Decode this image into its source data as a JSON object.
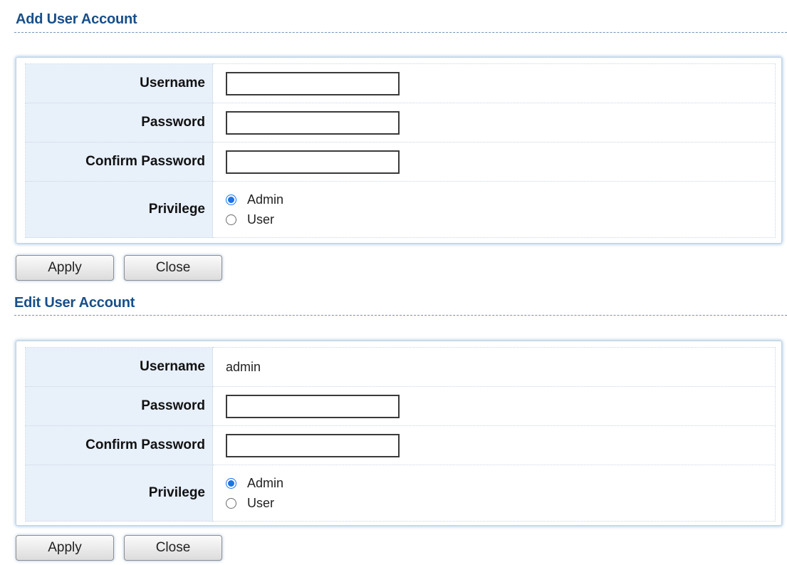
{
  "add_section": {
    "title": "Add User Account",
    "fields": {
      "username_label": "Username",
      "username_value": "",
      "password_label": "Password",
      "password_value": "",
      "confirm_label": "Confirm Password",
      "confirm_value": "",
      "privilege_label": "Privilege",
      "privilege_options": [
        "Admin",
        "User"
      ],
      "privilege_selected": "Admin"
    },
    "buttons": {
      "apply_label": "Apply",
      "close_label": "Close"
    }
  },
  "edit_section": {
    "title": "Edit User Account",
    "fields": {
      "username_label": "Username",
      "username_value": "admin",
      "password_label": "Password",
      "password_value": "",
      "confirm_label": "Confirm Password",
      "confirm_value": "",
      "privilege_label": "Privilege",
      "privilege_options": [
        "Admin",
        "User"
      ],
      "privilege_selected": "Admin"
    },
    "buttons": {
      "apply_label": "Apply",
      "close_label": "Close"
    }
  },
  "colors": {
    "title_blue": "#174f8a",
    "label_bg": "#e8f0fa",
    "radio_checked": "#1a73e8"
  },
  "icons": {
    "radio_checked": "radio-checked-icon",
    "radio_unchecked": "radio-unchecked-icon"
  }
}
